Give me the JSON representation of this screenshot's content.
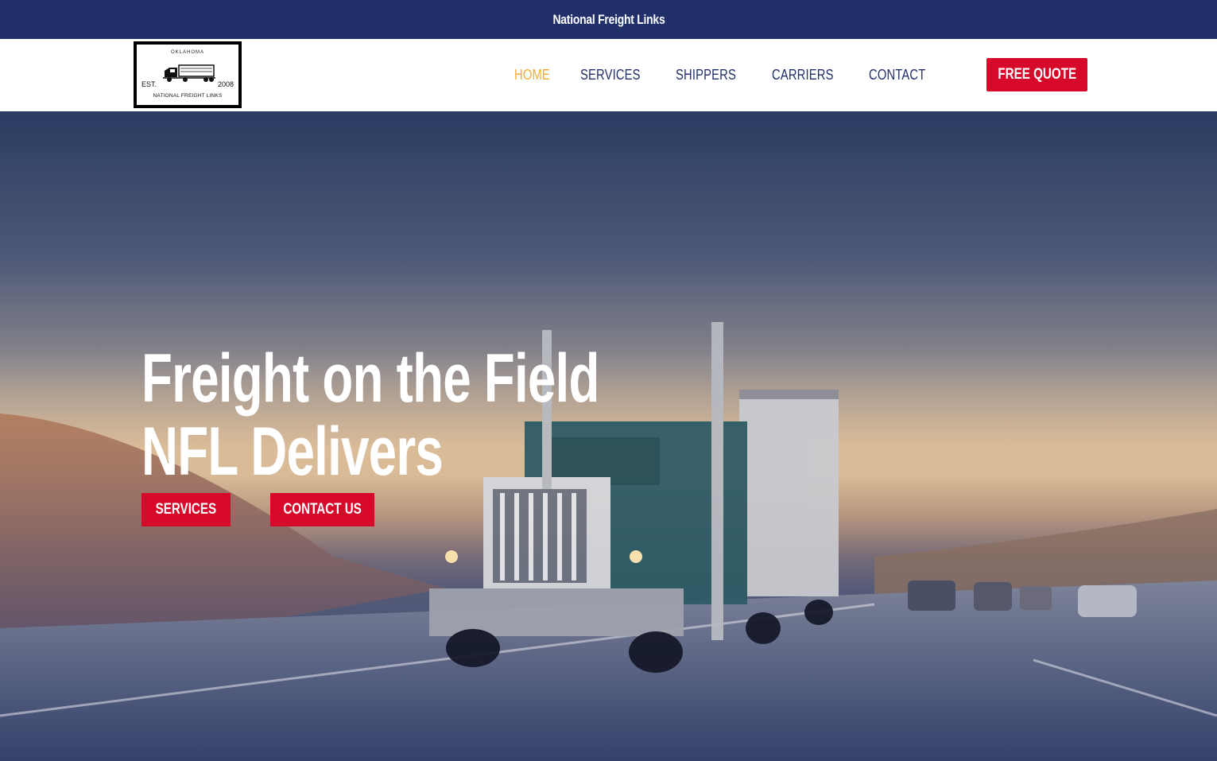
{
  "topbar": {
    "title": "National Freight Links"
  },
  "logo": {
    "state": "OKLAHOMA",
    "est": "EST.",
    "year": "2008",
    "name": "NATIONAL FREIGHT LINKS"
  },
  "nav": {
    "items": [
      {
        "label": "HOME",
        "active": true
      },
      {
        "label": "SERVICES",
        "active": false
      },
      {
        "label": "SHIPPERS",
        "active": false
      },
      {
        "label": "CARRIERS",
        "active": false
      },
      {
        "label": "CONTACT",
        "active": false
      }
    ]
  },
  "header": {
    "cta_label": "FREE QUOTE"
  },
  "hero": {
    "title_line1": "Freight on the Field",
    "title_line2": "NFL Delivers",
    "buttons": [
      {
        "label": "SERVICES"
      },
      {
        "label": "CONTACT US"
      }
    ]
  },
  "colors": {
    "navy": "#213069",
    "accent_red": "#d7092b",
    "active_nav": "#f3ab36"
  }
}
